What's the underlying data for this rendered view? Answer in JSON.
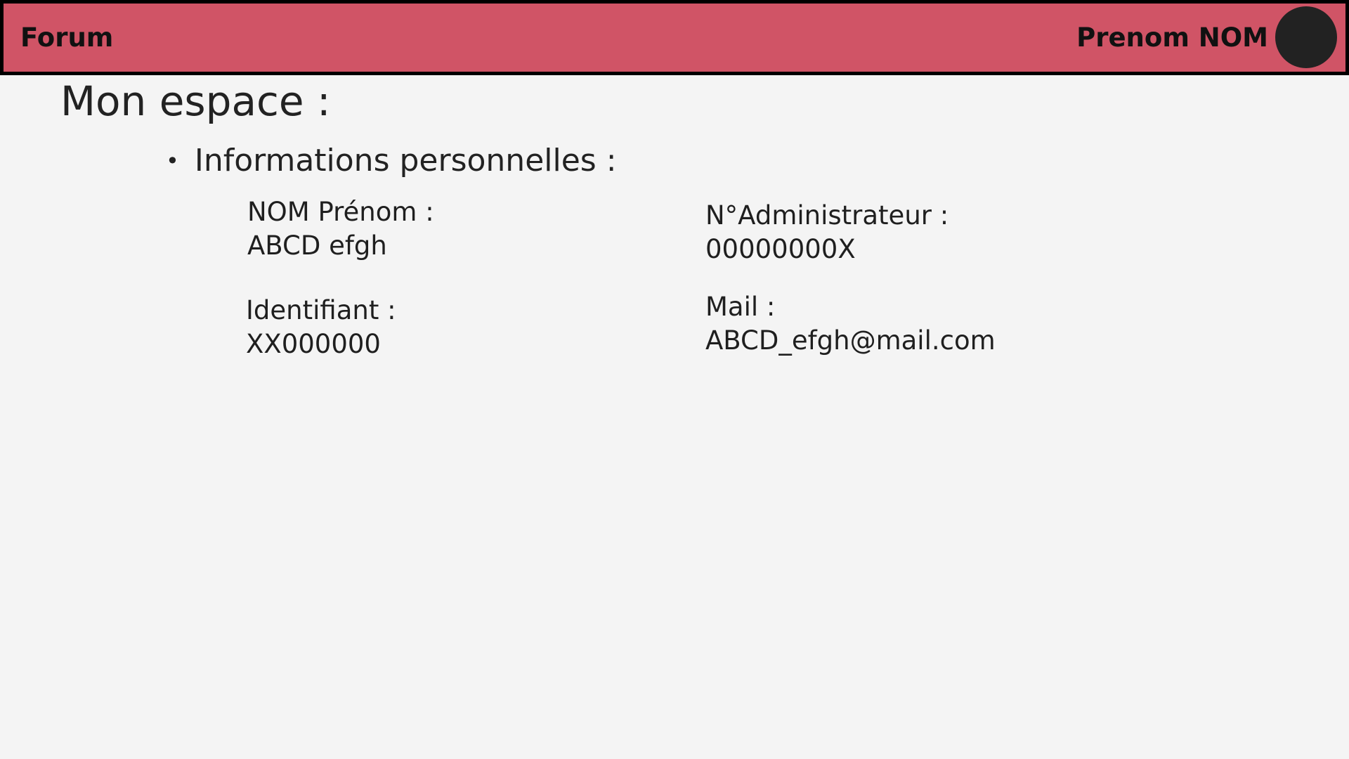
{
  "header": {
    "brand": "Forum",
    "user_name": "Prenom NOM"
  },
  "page": {
    "title": "Mon espace :"
  },
  "personal_info": {
    "heading": "Informations personnelles :",
    "bullet": "•",
    "name": {
      "label": "NOM Prénom :",
      "value": "ABCD efgh"
    },
    "admin_number": {
      "label": "N°Administrateur :",
      "value": "00000000X"
    },
    "login": {
      "label": "Identifiant :",
      "value": "XX000000"
    },
    "mail": {
      "label": "Mail :",
      "value": "ABCD_efgh@mail.com"
    }
  },
  "colors": {
    "header_background": "#d05466",
    "header_border": "#000000",
    "page_background": "#f4f4f4",
    "avatar": "#222222",
    "text": "#1f1f1f"
  },
  "icons": {
    "avatar": "avatar-circle"
  }
}
